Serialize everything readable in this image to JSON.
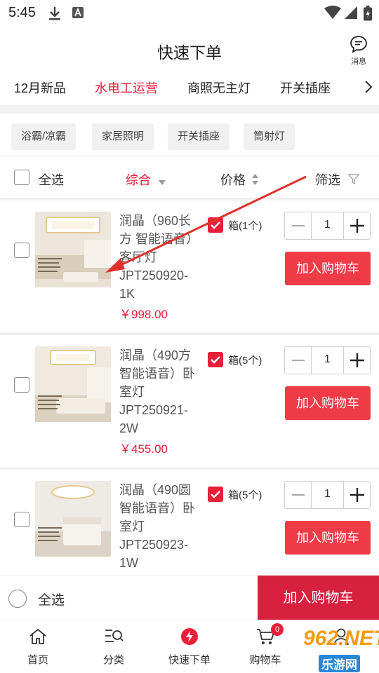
{
  "status": {
    "time": "5:45"
  },
  "header": {
    "title": "快速下单",
    "message_label": "消息"
  },
  "category_tabs": [
    {
      "label": "12月新品"
    },
    {
      "label": "水电工运营"
    },
    {
      "label": "商照无主灯"
    },
    {
      "label": "开关插座"
    }
  ],
  "sub_filters": [
    {
      "label": "浴霸/凉霸"
    },
    {
      "label": "家居照明"
    },
    {
      "label": "开关插座"
    },
    {
      "label": "筒射灯"
    }
  ],
  "sort": {
    "select_all": "全选",
    "comprehensive": "综合",
    "price": "价格",
    "filter": "筛选"
  },
  "products": [
    {
      "name_line1": "润晶（960长",
      "name_line2": "方 智能语音）",
      "name_line3": "客厅灯",
      "code_line1": "JPT250920-",
      "code_line2": "1K",
      "price": "￥998.00",
      "unit": "箱(1个)",
      "qty": "1",
      "add_label": "加入购物车"
    },
    {
      "name_line1": "润晶（490方",
      "name_line2": "智能语音）卧",
      "name_line3": "室灯",
      "code_line1": "JPT250921-",
      "code_line2": "2W",
      "price": "￥455.00",
      "unit": "箱(5个)",
      "qty": "1",
      "add_label": "加入购物车"
    },
    {
      "name_line1": "润晶（490圆",
      "name_line2": "智能语音）卧",
      "name_line3": "室灯",
      "code_line1": "JPT250923-",
      "code_line2": "1W",
      "price": "",
      "unit": "箱(5个)",
      "qty": "1",
      "add_label": "加入购物车"
    }
  ],
  "bottom_bar": {
    "select_all": "全选",
    "add_to_cart": "加入购物车"
  },
  "tabbar": [
    {
      "label": "首页",
      "icon": "home-icon"
    },
    {
      "label": "分类",
      "icon": "category-search-icon"
    },
    {
      "label": "快速下单",
      "icon": "lightning-icon"
    },
    {
      "label": "购物车",
      "icon": "cart-icon",
      "badge": "0"
    },
    {
      "label": "",
      "icon": "user-icon"
    }
  ],
  "watermark": {
    "top": "962.NET",
    "bottom": "乐游网"
  },
  "colors": {
    "accent": "#e8203a",
    "button": "#ef3b46",
    "cart_bar": "#d8203f"
  }
}
